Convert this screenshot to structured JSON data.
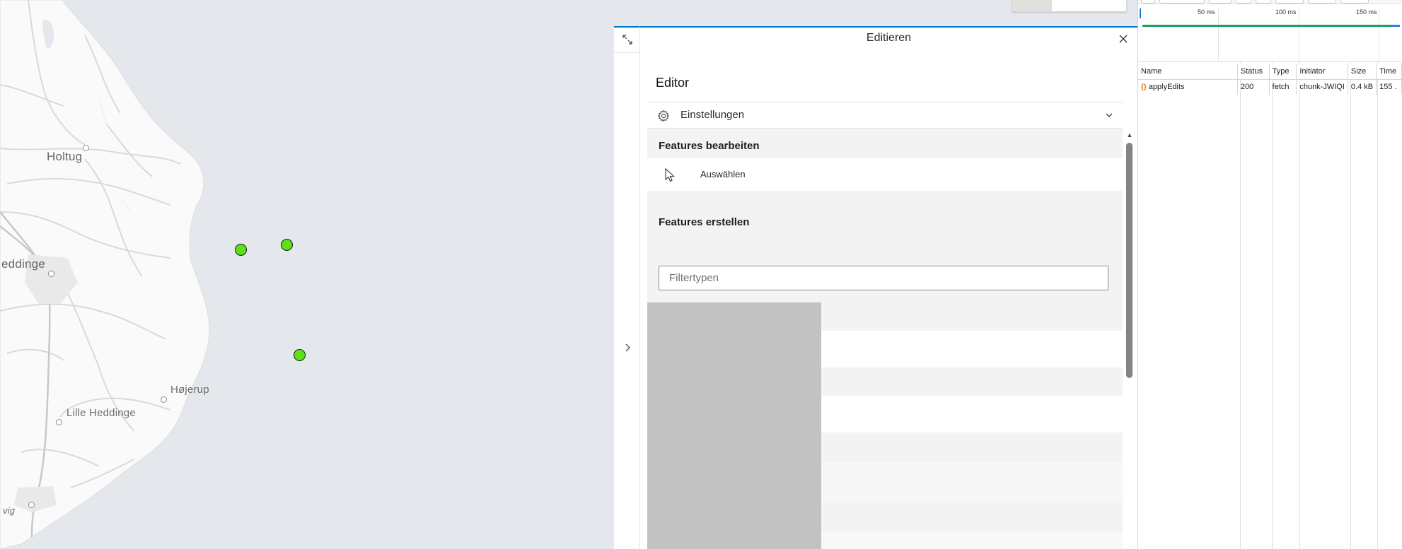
{
  "map": {
    "labels": {
      "holtug": "Holtug",
      "heddinge": "eddinge",
      "hojerup": "Højerup",
      "lille_heddinge": "Lille Heddinge",
      "vig": "vig"
    },
    "colors": {
      "land": "#fafafa",
      "water": "#e4e7eb",
      "roads": "#d8d8d8",
      "feature_point": "#5ee01a"
    }
  },
  "editor_panel": {
    "title": "Editieren",
    "close_icon": "close-icon",
    "expand_icon": "expand-icon",
    "collapse_icon": "chevron-right-icon",
    "heading": "Editor",
    "settings": {
      "label": "Einstellungen",
      "icon": "gear-icon",
      "chevron": "chevron-down-icon"
    },
    "edit_features": {
      "title": "Features bearbeiten",
      "select_label": "Auswählen",
      "select_icon": "cursor-icon"
    },
    "create_features": {
      "title": "Features erstellen",
      "filter_placeholder": "Filtertypen"
    },
    "accent_color": "#007ac2"
  },
  "devtools": {
    "timeline_ticks": [
      "50 ms",
      "100 ms",
      "150 ms"
    ],
    "columns": [
      "Name",
      "Status",
      "Type",
      "Initiator",
      "Size",
      "Time"
    ],
    "rows": [
      {
        "name": "applyEdits",
        "status": "200",
        "type": "fetch",
        "initiator": "chunk-JWIQI",
        "size": "0.4 kB",
        "time": "155 ."
      }
    ],
    "fetch_icon": "fetch-icon"
  }
}
